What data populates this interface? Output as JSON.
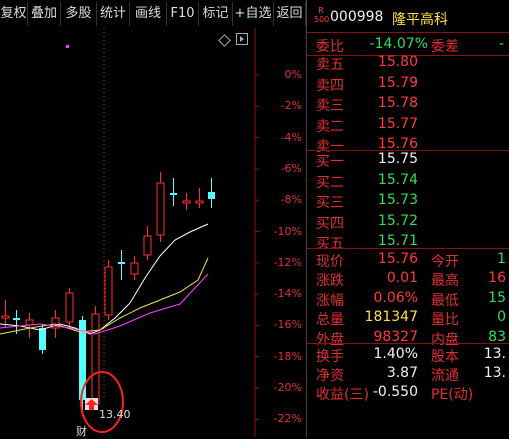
{
  "toolbar": {
    "items": [
      "复权",
      "叠加",
      "多股",
      "统计",
      "画线",
      "F10",
      "标记",
      "+自选",
      "返回"
    ]
  },
  "chart": {
    "pct_labels": [
      "0%",
      "-2%",
      "-4%",
      "-6%",
      "-8%",
      "-10%",
      "-12%",
      "-14%",
      "-16%",
      "-18%",
      "-20%",
      "-22%"
    ],
    "low_price_label": "13.40",
    "bottom_marker": "财",
    "colors": {
      "up": "#ff3030",
      "down": "#54ffff",
      "ma5": "#ffffff",
      "ma10": "#f0e040",
      "ma20": "#ff40ff",
      "circle": "#ff2020"
    }
  },
  "quote": {
    "badge_top": "R",
    "badge_bottom": "500",
    "code": "000998",
    "name": "隆平高科",
    "weibi_label": "委比",
    "weibi_value": "-14.07%",
    "weicha_label": "委差",
    "weicha_value": "-",
    "asks": [
      {
        "label": "卖五",
        "price": "15.80"
      },
      {
        "label": "卖四",
        "price": "15.79"
      },
      {
        "label": "卖三",
        "price": "15.78"
      },
      {
        "label": "卖二",
        "price": "15.77"
      },
      {
        "label": "卖一",
        "price": "15.76"
      }
    ],
    "bids": [
      {
        "label": "买一",
        "price": "15.75"
      },
      {
        "label": "买二",
        "price": "15.74"
      },
      {
        "label": "买三",
        "price": "15.73"
      },
      {
        "label": "买四",
        "price": "15.72"
      },
      {
        "label": "买五",
        "price": "15.71"
      }
    ],
    "stats_left": [
      {
        "label": "现价",
        "value": "15.76",
        "color": "red"
      },
      {
        "label": "涨跌",
        "value": "0.01",
        "color": "red"
      },
      {
        "label": "涨幅",
        "value": "0.06%",
        "color": "red"
      },
      {
        "label": "总量",
        "value": "181347",
        "color": "yellow"
      },
      {
        "label": "外盘",
        "value": "98327",
        "color": "red"
      }
    ],
    "stats_right": [
      {
        "label": "今开",
        "value": "1",
        "color": "green"
      },
      {
        "label": "最高",
        "value": "16",
        "color": "red"
      },
      {
        "label": "最低",
        "value": "15",
        "color": "green"
      },
      {
        "label": "量比",
        "value": "0",
        "color": "green"
      },
      {
        "label": "内盘",
        "value": "83",
        "color": "green"
      }
    ],
    "fin_left": [
      {
        "label": "换手",
        "value": "1.40%",
        "color": "white"
      },
      {
        "label": "净资",
        "value": "3.87",
        "color": "white"
      },
      {
        "label": "收益(三)",
        "value": "-0.550",
        "color": "white"
      }
    ],
    "fin_right": [
      {
        "label": "股本",
        "value": "13.",
        "color": "white"
      },
      {
        "label": "流通",
        "value": "13.",
        "color": "white"
      },
      {
        "label": "PE(动)",
        "value": "",
        "color": "white"
      }
    ]
  }
}
